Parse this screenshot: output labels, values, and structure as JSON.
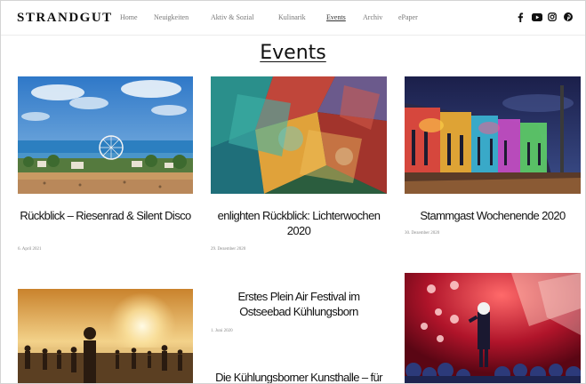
{
  "header": {
    "logo": "STRANDGUT",
    "nav": [
      {
        "label": "Home"
      },
      {
        "label": "Neuigkeiten"
      },
      {
        "label": "Aktiv & Sozial"
      },
      {
        "label": "Kulinarik"
      },
      {
        "label": "Events",
        "active": true
      },
      {
        "label": "Archiv"
      },
      {
        "label": "ePaper"
      }
    ],
    "social_icons": [
      "facebook-icon",
      "youtube-icon",
      "instagram-icon",
      "pinterest-icon"
    ]
  },
  "page": {
    "title": "Events"
  },
  "events": [
    {
      "title": "Rückblick – Riesenrad & Silent Disco",
      "date": "6. April 2021"
    },
    {
      "title": "enlighten Rückblick: Lichterwochen 2020",
      "date": "29. Dezember 2020"
    },
    {
      "title": "Stammgast Wochenende 2020",
      "date": "30. Dezember 2020"
    },
    {
      "title": "",
      "date": ""
    },
    {
      "title": "Erstes Plein Air Festival im Ostseebad Kühlungsborn",
      "date": "1. Juni 2020"
    },
    {
      "title": "Die Kühlungsborner Kunsthalle – für",
      "date": ""
    }
  ],
  "colors": {
    "text": "#111111",
    "nav": "#777777",
    "muted": "#888888",
    "border": "#d4d4d4"
  }
}
